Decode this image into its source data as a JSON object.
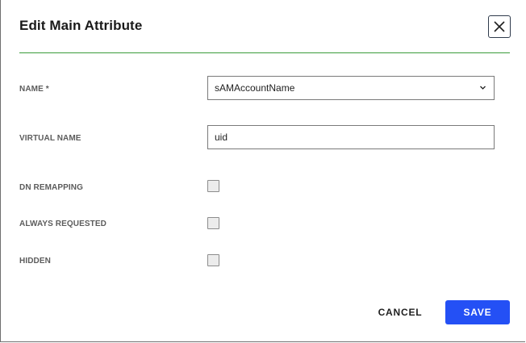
{
  "dialog": {
    "title": "Edit Main Attribute",
    "close_icon": "close-icon"
  },
  "fields": {
    "name": {
      "label": "NAME *",
      "value": "sAMAccountName",
      "icon": "chevron-down-icon"
    },
    "virtual_name": {
      "label": "VIRTUAL NAME",
      "value": "uid"
    }
  },
  "checkboxes": {
    "dn_remapping": {
      "label": "DN REMAPPING",
      "checked": false
    },
    "always_requested": {
      "label": "ALWAYS REQUESTED",
      "checked": false
    },
    "hidden": {
      "label": "HIDDEN",
      "checked": false
    }
  },
  "actions": {
    "cancel_label": "CANCEL",
    "save_label": "SAVE"
  },
  "colors": {
    "divider": "#3a9b3a",
    "primary": "#2450f5"
  }
}
